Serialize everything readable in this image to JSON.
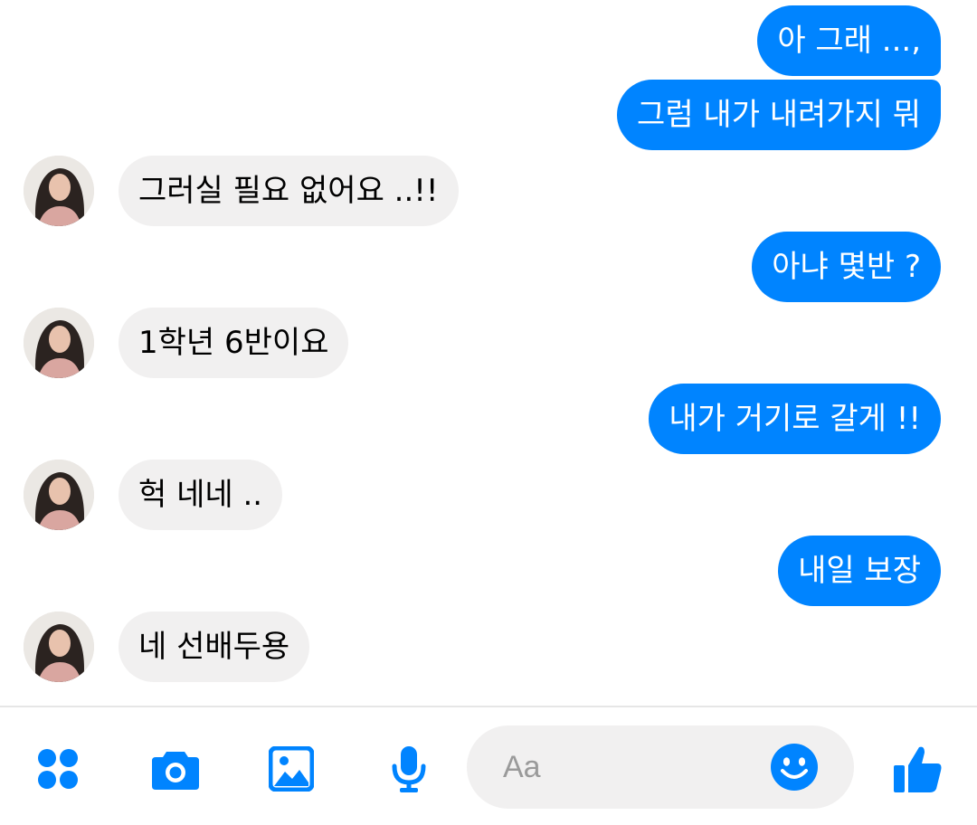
{
  "messages": [
    {
      "side": "out",
      "text": "아 그래 ...,"
    },
    {
      "side": "out",
      "text": "그럼 내가 내려가지 뭐"
    },
    {
      "side": "in",
      "text": "그러실 필요 없어요 ..!!"
    },
    {
      "side": "out",
      "text": "아냐 몇반 ?"
    },
    {
      "side": "in",
      "text": "1학년 6반이요"
    },
    {
      "side": "out",
      "text": "내가 거기로 갈게 !!"
    },
    {
      "side": "in",
      "text": "헉 네네 .."
    },
    {
      "side": "out",
      "text": "내일 보장"
    },
    {
      "side": "in",
      "text": "네 선배두용"
    }
  ],
  "composer": {
    "placeholder": "Aa",
    "icons": [
      "apps-icon",
      "camera-icon",
      "image-icon",
      "mic-icon",
      "emoji-icon",
      "like-icon"
    ]
  },
  "colors": {
    "accent": "#0084ff",
    "incoming_bubble": "#f1f0f0",
    "outgoing_text": "#ffffff",
    "incoming_text": "#000000"
  }
}
